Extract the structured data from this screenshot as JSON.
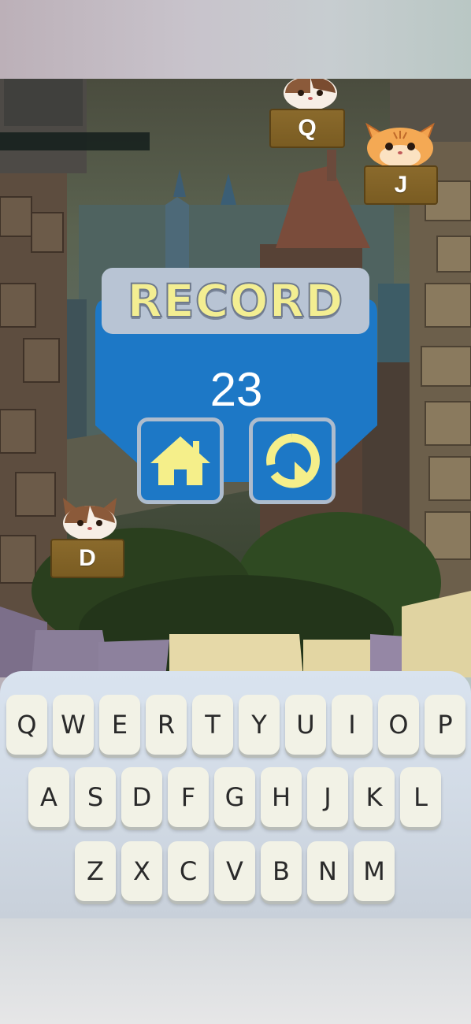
{
  "game": {
    "falling_cats": [
      {
        "letter": "Q",
        "breed": "calico"
      },
      {
        "letter": "J",
        "breed": "orange-tabby"
      },
      {
        "letter": "D",
        "breed": "calico"
      }
    ]
  },
  "record_panel": {
    "title": "RECORD",
    "score": "23",
    "home_icon": "home-icon",
    "restart_icon": "restart-icon"
  },
  "keyboard": {
    "rows": [
      [
        "Q",
        "W",
        "E",
        "R",
        "T",
        "Y",
        "U",
        "I",
        "O",
        "P"
      ],
      [
        "A",
        "S",
        "D",
        "F",
        "G",
        "H",
        "J",
        "K",
        "L"
      ],
      [
        "Z",
        "X",
        "C",
        "V",
        "B",
        "N",
        "M"
      ]
    ]
  },
  "colors": {
    "panel_blue": "#1d78c6",
    "title_yellow": "#f3ee92",
    "icon_yellow": "#f5ef8a",
    "plank_brown": "#7f6026"
  }
}
